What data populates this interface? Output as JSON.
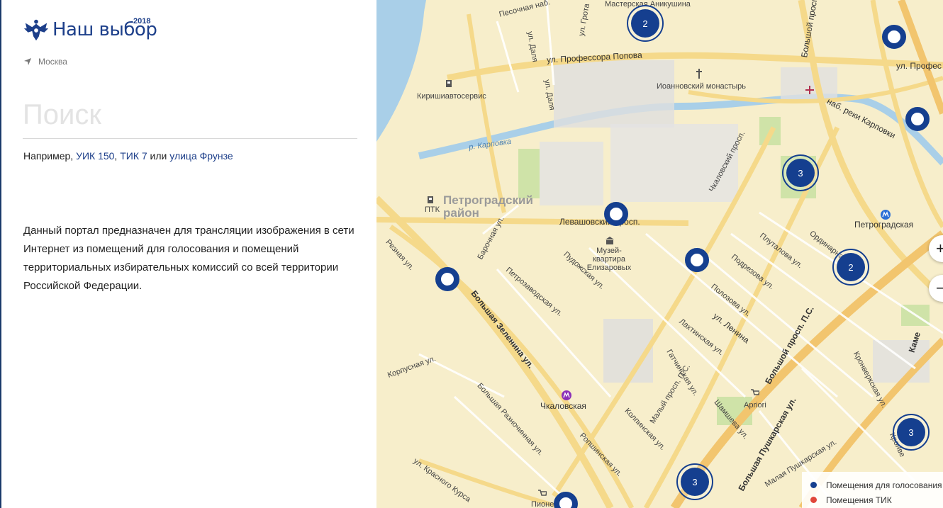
{
  "header": {
    "brand": "Наш выбор",
    "year": "2018",
    "city": "Москва"
  },
  "search": {
    "placeholder": "Поиск"
  },
  "hint": {
    "prefix": "Например, ",
    "link1": "УИК 150",
    "sep": ", ",
    "link2": "ТИК 7",
    "or": " или ",
    "link3": "улица Фрунзе"
  },
  "description": "Данный портал предназначен для трансляции изображения в сети Интернет из помещений для голосования и помещений территориальных избирательных комиссий со всей территории Российской Федерации.",
  "map": {
    "labels": {
      "pesochnaya": "Песочная наб.",
      "masterskaya": "Мастерская Аникушина",
      "grota": "ул. Грота",
      "dalya1": "ул. Даля",
      "dalya2": "ул. Даля",
      "popova1": "ул. Профессора Попова",
      "popova2": "ул. Профес",
      "kirishi": "Киришиавтосервис",
      "ioannovsky": "Иоанновский монастырь",
      "karpovka_riv": "р. Карповка",
      "karpovka_emb": "наб. реки Карповки",
      "bolshoy": "Большой просп.",
      "chkalovsky_pr": "Чкаловский просп.",
      "ptk": "ПТК",
      "district": "Петроградский район",
      "levashovsky": "Левашовский просп.",
      "museum": "Музей-квартира Елизаровых",
      "petrogradskaya": "Петроградская",
      "ordinarnaya": "Ординарна",
      "plutalova": "Плуталова ул.",
      "podrezova": "Подрезова ул.",
      "polozova": "Полозова ул.",
      "lenina": "ул. Ленина",
      "lakhtinskaya": "Лахтинская ул.",
      "reznaya": "Резная ул.",
      "barochnaya": "Барочная ул.",
      "petrozavodskaya": "Петрозаводская ул.",
      "pudozhskaya": "Пудожская ул.",
      "b_zelenina": "Большая Зеленина ул.",
      "gatchinskaya": "Гатчинская ул.",
      "b_prosp_ps": "Большой просп. П.С.",
      "korpusnaya": "Корпусная ул.",
      "chkalovskaya": "Чкаловская",
      "maly_prosp": "Малый просп. П.С.",
      "shamsheva": "Шамшева ул.",
      "apriori": "Apriori",
      "kronverkskaya": "Кронверкская ул.",
      "b_razno": "Большая Разночинная ул.",
      "kollinsa": "Колпинская ул.",
      "ropshinskaya": "Ропшинская ул.",
      "b_pushkarskaya": "Большая Пушкарская ул.",
      "m_pushkarskaya": "Малая Пушкарская ул.",
      "krasnogo": "ул. Красного Курса",
      "pioner": "Пионер",
      "kame": "Каме",
      "kronv2": "Кронве"
    },
    "clusters": [
      "2",
      "3",
      "2",
      "3",
      "3"
    ],
    "zoom_in": "+",
    "zoom_out": "−",
    "legend": {
      "polling": "Помещения для голосования",
      "tik": "Помещения ТИК",
      "polling_color": "#153f8f",
      "tik_color": "#e0463a"
    }
  }
}
